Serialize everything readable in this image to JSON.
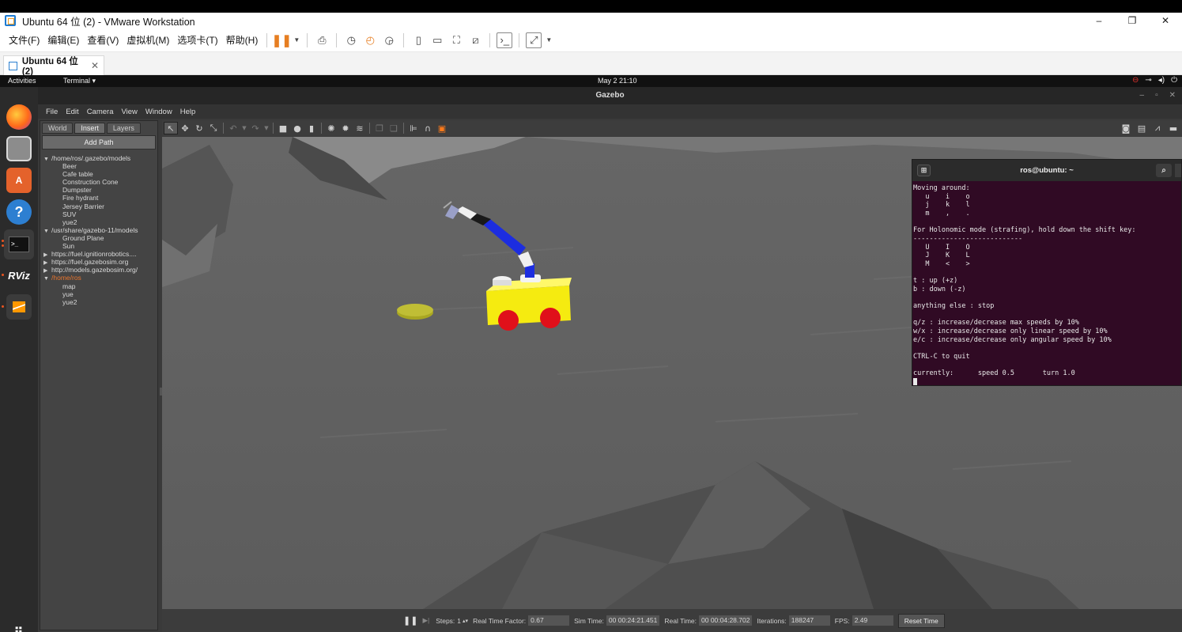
{
  "vmware": {
    "window_title": "Ubuntu 64 位 (2) - VMware Workstation",
    "window_controls": {
      "minimize": "‒",
      "restore": "❐",
      "close": "✕"
    },
    "menu": [
      "文件(F)",
      "编辑(E)",
      "查看(V)",
      "虚拟机(M)",
      "选项卡(T)",
      "帮助(H)"
    ],
    "tab_label": "Ubuntu 64 位 (2)",
    "tab_close": "✕"
  },
  "ubuntu": {
    "topbar": {
      "activities": "Activities",
      "app_menu": "Terminal ▾",
      "clock": "May 2  21:10",
      "tray_icons": [
        "record-icon",
        "network-icon",
        "volume-icon",
        "power-icon"
      ]
    },
    "dock": [
      "firefox-icon",
      "files-icon",
      "app-store-icon",
      "help-icon",
      "terminal-icon",
      "rviz-icon",
      "sublime-icon",
      "show-apps-icon"
    ],
    "dock_labels": {
      "rviz": "RViz",
      "help": "?",
      "terminal": ">_",
      "apps": "⠿"
    }
  },
  "gazebo": {
    "window_title": "Gazebo",
    "window_controls": {
      "minimize": "–",
      "restore": "▫",
      "close": "✕"
    },
    "menu": [
      "File",
      "Edit",
      "Camera",
      "View",
      "Window",
      "Help"
    ],
    "left_tabs": [
      "World",
      "Insert",
      "Layers"
    ],
    "active_tab": "Insert",
    "add_path": "Add Path",
    "tree": [
      {
        "label": "/home/ros/.gazebo/models",
        "expanded": true,
        "children": [
          "Beer",
          "Cafe table",
          "Construction Cone",
          "Dumpster",
          "Fire hydrant",
          "Jersey Barrier",
          "SUV",
          "yue2"
        ]
      },
      {
        "label": "/usr/share/gazebo-11/models",
        "expanded": true,
        "children": [
          "Ground Plane",
          "Sun"
        ]
      },
      {
        "label": "https://fuel.ignitionrobotics....",
        "expanded": false,
        "children": []
      },
      {
        "label": "https://fuel.gazebosim.org",
        "expanded": false,
        "children": []
      },
      {
        "label": "http://models.gazebosim.org/",
        "expanded": false,
        "children": []
      },
      {
        "label": "/home/ros",
        "expanded": true,
        "highlight": true,
        "children": [
          "map",
          "yue",
          "yue2"
        ]
      }
    ],
    "status": {
      "steps_label": "Steps:",
      "steps_value": "1",
      "rtf_label": "Real Time Factor:",
      "rtf_value": "0.67",
      "sim_time_label": "Sim Time:",
      "sim_time_value": "00 00:24:21.451",
      "real_time_label": "Real Time:",
      "real_time_value": "00 00:04:28.702",
      "iterations_label": "Iterations:",
      "iterations_value": "188247",
      "fps_label": "FPS:",
      "fps_value": "2.49",
      "reset_label": "Reset Time"
    },
    "scene_colors": {
      "ground": "#6e6e6e",
      "robot_body": "#f5eb10",
      "wheels": "#e0101a",
      "arm_blue": "#1c2de0",
      "arm_white": "#f2f2f2",
      "disc": "#b3b129"
    }
  },
  "terminal": {
    "title": "ros@ubuntu: ~",
    "lines": [
      "Moving around:",
      "   u    i    o",
      "   j    k    l",
      "   m    ,    .",
      "",
      "For Holonomic mode (strafing), hold down the shift key:",
      "---------------------------",
      "   U    I    O",
      "   J    K    L",
      "   M    <    >",
      "",
      "t : up (+z)",
      "b : down (-z)",
      "",
      "anything else : stop",
      "",
      "q/z : increase/decrease max speeds by 10%",
      "w/x : increase/decrease only linear speed by 10%",
      "e/c : increase/decrease only angular speed by 10%",
      "",
      "CTRL-C to quit",
      "",
      "currently:      speed 0.5       turn 1.0"
    ]
  }
}
